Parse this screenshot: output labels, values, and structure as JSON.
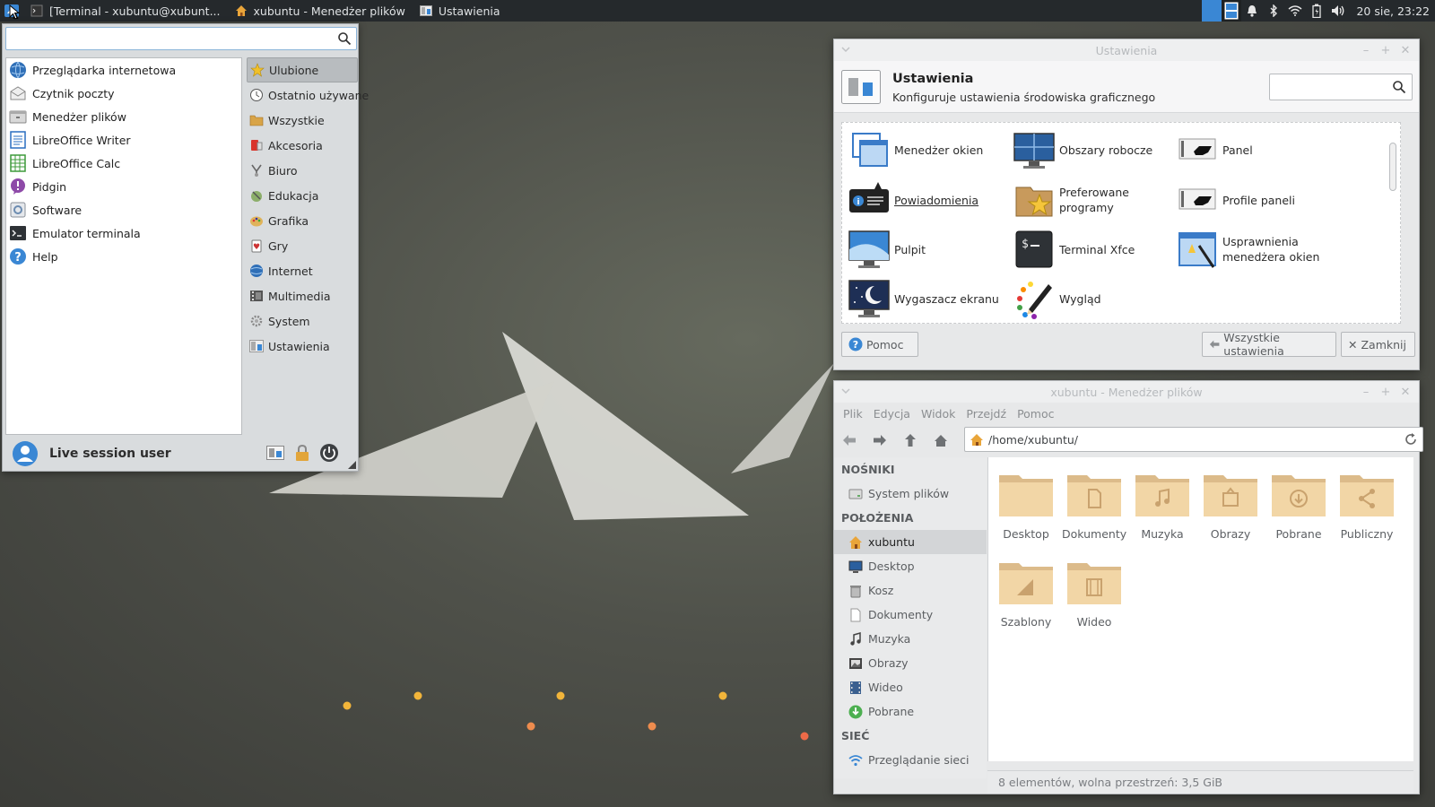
{
  "panel": {
    "tasks": [
      {
        "label": "[Terminal - xubuntu@xubunt..."
      },
      {
        "label": "xubuntu - Menedżer plików"
      },
      {
        "label": "Ustawienia"
      }
    ],
    "clock": "20 sie, 23:22"
  },
  "menu": {
    "search_placeholder": "",
    "favorites": [
      {
        "label": "Przeglądarka internetowa",
        "icon": "globe-icon"
      },
      {
        "label": "Czytnik poczty",
        "icon": "mail-icon"
      },
      {
        "label": "Menedżer plików",
        "icon": "file-manager-icon"
      },
      {
        "label": "LibreOffice Writer",
        "icon": "writer-icon"
      },
      {
        "label": "LibreOffice Calc",
        "icon": "calc-icon"
      },
      {
        "label": "Pidgin",
        "icon": "pidgin-icon"
      },
      {
        "label": "Software",
        "icon": "software-icon"
      },
      {
        "label": "Emulator terminala",
        "icon": "terminal-icon"
      },
      {
        "label": "Help",
        "icon": "help-icon"
      }
    ],
    "categories": [
      {
        "label": "Ulubione",
        "active": true
      },
      {
        "label": "Ostatnio używane"
      },
      {
        "label": "Wszystkie"
      },
      {
        "label": "Akcesoria"
      },
      {
        "label": "Biuro"
      },
      {
        "label": "Edukacja"
      },
      {
        "label": "Grafika"
      },
      {
        "label": "Gry"
      },
      {
        "label": "Internet"
      },
      {
        "label": "Multimedia"
      },
      {
        "label": "System"
      },
      {
        "label": "Ustawienia"
      }
    ],
    "user_name": "Live session user"
  },
  "settings": {
    "window_title": "Ustawienia",
    "header_title": "Ustawienia",
    "header_subtitle": "Konfiguruje ustawienia środowiska graficznego",
    "items": [
      {
        "label": "Menedżer okien"
      },
      {
        "label": "Obszary robocze"
      },
      {
        "label": "Panel"
      },
      {
        "label": "Powiadomienia"
      },
      {
        "label": "Preferowane programy"
      },
      {
        "label": "Profile paneli"
      },
      {
        "label": "Pulpit"
      },
      {
        "label": "Terminal Xfce"
      },
      {
        "label": "Usprawnienia menedżera okien"
      },
      {
        "label": "Wygaszacz ekranu"
      },
      {
        "label": "Wygląd"
      }
    ],
    "help_label": "Pomoc",
    "all_settings_label": "Wszystkie ustawienia",
    "close_label": "Zamknij"
  },
  "filemanager": {
    "window_title": "xubuntu - Menedżer plików",
    "menus": [
      "Plik",
      "Edycja",
      "Widok",
      "Przejdź",
      "Pomoc"
    ],
    "path": "/home/xubuntu/",
    "sidebar": {
      "devices_header": "NOŚNIKI",
      "devices": [
        {
          "label": "System plików"
        }
      ],
      "places_header": "POŁOŻENIA",
      "places": [
        {
          "label": "xubuntu",
          "active": true
        },
        {
          "label": "Desktop"
        },
        {
          "label": "Kosz"
        },
        {
          "label": "Dokumenty"
        },
        {
          "label": "Muzyka"
        },
        {
          "label": "Obrazy"
        },
        {
          "label": "Wideo"
        },
        {
          "label": "Pobrane"
        }
      ],
      "network_header": "SIEĆ",
      "network": [
        {
          "label": "Przeglądanie sieci"
        }
      ]
    },
    "folders": [
      {
        "label": "Desktop"
      },
      {
        "label": "Dokumenty"
      },
      {
        "label": "Muzyka"
      },
      {
        "label": "Obrazy"
      },
      {
        "label": "Pobrane"
      },
      {
        "label": "Publiczny"
      },
      {
        "label": "Szablony"
      },
      {
        "label": "Wideo"
      }
    ],
    "status": "8 elementów, wolna przestrzeń: 3,5 GiB"
  }
}
